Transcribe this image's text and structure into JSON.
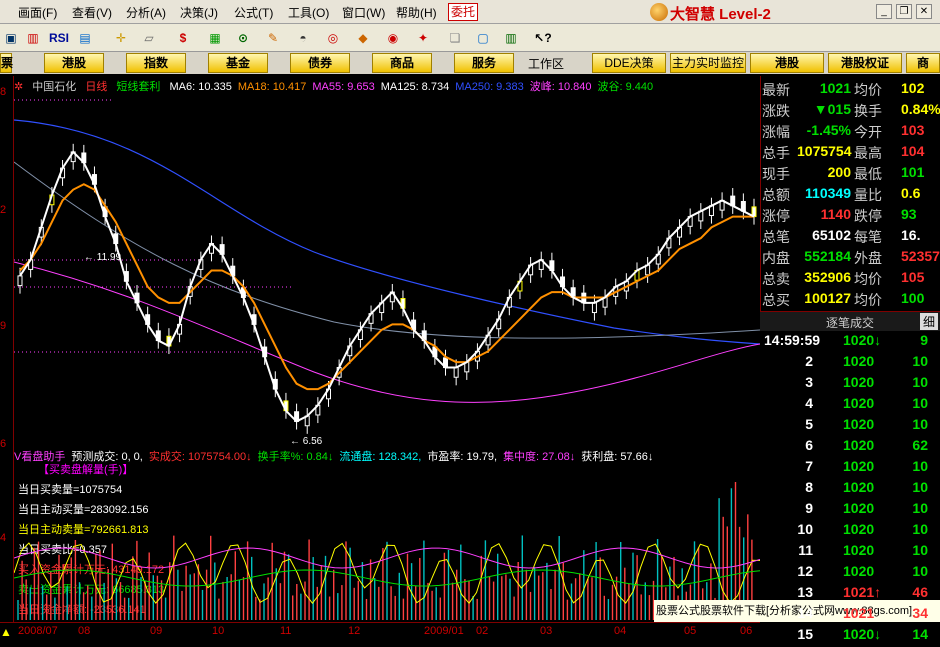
{
  "menu": [
    "画面(F)",
    "查看(V)",
    "分析(A)",
    "决策(J)",
    "公式(T)",
    "工具(O)",
    "窗口(W)",
    "帮助(H)"
  ],
  "menu_entrust": "委托",
  "brand": "大智慧 Level-2",
  "toolbar": {
    "rsi_label": "RSI",
    "dollar_label": "$"
  },
  "tabs": [
    "港股",
    "指数",
    "基金",
    "债券",
    "商品",
    "服务"
  ],
  "tabs_right": [
    "DDE决策",
    "主力实时监控",
    "港股",
    "港股权证",
    "商"
  ],
  "left_tab_stub": "票",
  "workspace_label": "工作区",
  "chart": {
    "title": "中国石化",
    "period": "日线",
    "indicator_name": "短线套利",
    "ma": [
      {
        "label": "MA6: 10.335",
        "color": "#ffffff"
      },
      {
        "label": "MA18: 10.417",
        "color": "#ff9000"
      },
      {
        "label": "MA55: 9.653",
        "color": "#ff40ff"
      },
      {
        "label": "MA125: 8.734",
        "color": "#ffffff"
      },
      {
        "label": "MA250: 9.383",
        "color": "#3050ff"
      },
      {
        "label": "波峰: 10.840",
        "color": "#ff40ff"
      },
      {
        "label": "波谷: 9.440",
        "color": "#00e000"
      }
    ],
    "annotations": {
      "high": "11.99",
      "low": "6.56"
    },
    "axis_labels": [
      "8",
      "2",
      "9",
      "6",
      "4"
    ],
    "dates": [
      "2008/07",
      "08",
      "09",
      "10",
      "11",
      "12",
      "2009/01",
      "02",
      "03",
      "04",
      "05",
      "06"
    ]
  },
  "chart_data": {
    "type": "candlestick",
    "series": [
      {
        "name": "MA6",
        "values": [
          9.3,
          9.6,
          10.2,
          10.8,
          11.3,
          11.6,
          11.4,
          11.0,
          10.4,
          9.9,
          9.2,
          8.8,
          8.4,
          8.1,
          8.0,
          8.4,
          9.1,
          9.6,
          9.9,
          9.7,
          9.3,
          8.9,
          8.4,
          7.8,
          7.2,
          6.8,
          6.6,
          6.7,
          6.9,
          7.2,
          7.6,
          8.0,
          8.3,
          8.6,
          8.8,
          9.0,
          8.7,
          8.3,
          8.1,
          7.8,
          7.6,
          7.6,
          7.7,
          7.9,
          8.2,
          8.5,
          8.9,
          9.2,
          9.5,
          9.6,
          9.4,
          9.1,
          8.9,
          8.8,
          8.8,
          8.9,
          9.1,
          9.2,
          9.4,
          9.5,
          9.7,
          10.0,
          10.2,
          10.4,
          10.5,
          10.6,
          10.7,
          10.6,
          10.5,
          10.4
        ]
      },
      {
        "name": "MA18",
        "values": [
          9.4,
          9.6,
          9.9,
          10.3,
          10.7,
          10.9,
          11.0,
          10.9,
          10.6,
          10.3,
          9.9,
          9.5,
          9.1,
          8.9,
          8.8,
          8.8,
          9.0,
          9.2,
          9.4,
          9.4,
          9.3,
          9.1,
          8.8,
          8.4,
          8.0,
          7.6,
          7.3,
          7.2,
          7.2,
          7.3,
          7.5,
          7.7,
          7.9,
          8.1,
          8.3,
          8.4,
          8.4,
          8.3,
          8.1,
          8.0,
          7.8,
          7.7,
          7.7,
          7.8,
          7.9,
          8.1,
          8.3,
          8.5,
          8.7,
          8.9,
          9.0,
          9.0,
          8.9,
          8.9,
          8.9,
          8.9,
          9.0,
          9.1,
          9.2,
          9.3,
          9.4,
          9.6,
          9.8,
          9.9,
          10.0,
          10.2,
          10.3,
          10.4,
          10.4,
          10.4
        ]
      }
    ]
  },
  "indicator": {
    "header": [
      {
        "text": "V看盘助手",
        "color": "#ff40ff"
      },
      {
        "text": "预测成交: 0, 0,",
        "color": "#ffffff"
      },
      {
        "text": "实成交: 1075754.00↓",
        "color": "#ff3030"
      },
      {
        "text": "换手率%: 0.84↓",
        "color": "#00e000"
      },
      {
        "text": "流通盘: 128.342,",
        "color": "#00ffff"
      },
      {
        "text": "市盈率: 19.79,",
        "color": "#ffffff"
      },
      {
        "text": "集中度: 27.08↓",
        "color": "#ff40ff"
      },
      {
        "text": "获利盘: 57.66↓",
        "color": "#ffffff"
      }
    ],
    "subheader": "【买卖盘解量(手)】",
    "lines": [
      {
        "text": "当日买卖量=1075754",
        "color": "#ffffff"
      },
      {
        "text": "当日主动买量=283092.156",
        "color": "#ffffff"
      },
      {
        "text": "当日主动卖量=792661.813",
        "color": "#ffff00"
      },
      {
        "text": "当日买卖比=0.357",
        "color": "#ffffff"
      },
      {
        "text": "买入资金累计万元: 43149.172",
        "color": "#ff3030"
      },
      {
        "text": "卖出资金累计万元: 66685.313",
        "color": "#00e000"
      },
      {
        "text": "当日资金净额: -23536.141",
        "color": "#ff3030"
      }
    ]
  },
  "watermark": "股票公式股票软件下载[分析家公式网www.88gs.com]",
  "quote": [
    {
      "l1": "最新",
      "v1": "1021",
      "c1": "#00e000",
      "l2": "均价",
      "v2": "102",
      "c2": "#ffff00"
    },
    {
      "l1": "涨跌",
      "v1": "▼015",
      "c1": "#00e000",
      "l2": "换手",
      "v2": "0.84%",
      "c2": "#ffff00"
    },
    {
      "l1": "涨幅",
      "v1": "-1.45%",
      "c1": "#00e000",
      "l2": "今开",
      "v2": "103",
      "c2": "#ff3030"
    },
    {
      "l1": "总手",
      "v1": "1075754",
      "c1": "#ffff00",
      "l2": "最高",
      "v2": "104",
      "c2": "#ff3030"
    },
    {
      "l1": "现手",
      "v1": "200",
      "c1": "#ffff00",
      "l2": "最低",
      "v2": "101",
      "c2": "#00e000"
    },
    {
      "l1": "总额",
      "v1": "110349",
      "c1": "#00ffff",
      "l2": "量比",
      "v2": "0.6",
      "c2": "#ffff00"
    },
    {
      "l1": "涨停",
      "v1": "1140",
      "c1": "#ff3030",
      "l2": "跌停",
      "v2": "93",
      "c2": "#00e000"
    },
    {
      "l1": "总笔",
      "v1": "65102",
      "c1": "#ffffff",
      "l2": "每笔",
      "v2": "16.",
      "c2": "#ffffff"
    },
    {
      "l1": "内盘",
      "v1": "552184",
      "c1": "#00e000",
      "l2": "外盘",
      "v2": "52357",
      "c2": "#ff3030"
    },
    {
      "l1": "总卖",
      "v1": "352906",
      "c1": "#ffff00",
      "l2": "均价",
      "v2": "105",
      "c2": "#ff3030"
    },
    {
      "l1": "总买",
      "v1": "100127",
      "c1": "#ffff00",
      "l2": "均价",
      "v2": "100",
      "c2": "#00e000"
    }
  ],
  "ticks_header": "逐笔成交",
  "ticks_detail": "细",
  "ticks": [
    {
      "idx": "14:59:59",
      "price": "1020↓",
      "pc": "#00e000",
      "vol": "9",
      "vc": "#00e000"
    },
    {
      "idx": "2",
      "price": "1020",
      "pc": "#00e000",
      "vol": "10",
      "vc": "#00e000"
    },
    {
      "idx": "3",
      "price": "1020",
      "pc": "#00e000",
      "vol": "10",
      "vc": "#00e000"
    },
    {
      "idx": "4",
      "price": "1020",
      "pc": "#00e000",
      "vol": "10",
      "vc": "#00e000"
    },
    {
      "idx": "5",
      "price": "1020",
      "pc": "#00e000",
      "vol": "10",
      "vc": "#00e000"
    },
    {
      "idx": "6",
      "price": "1020",
      "pc": "#00e000",
      "vol": "62",
      "vc": "#00e000"
    },
    {
      "idx": "7",
      "price": "1020",
      "pc": "#00e000",
      "vol": "10",
      "vc": "#00e000"
    },
    {
      "idx": "8",
      "price": "1020",
      "pc": "#00e000",
      "vol": "10",
      "vc": "#00e000"
    },
    {
      "idx": "9",
      "price": "1020",
      "pc": "#00e000",
      "vol": "10",
      "vc": "#00e000"
    },
    {
      "idx": "10",
      "price": "1020",
      "pc": "#00e000",
      "vol": "10",
      "vc": "#00e000"
    },
    {
      "idx": "11",
      "price": "1020",
      "pc": "#00e000",
      "vol": "10",
      "vc": "#00e000"
    },
    {
      "idx": "12",
      "price": "1020",
      "pc": "#00e000",
      "vol": "10",
      "vc": "#00e000"
    },
    {
      "idx": "13",
      "price": "1021↑",
      "pc": "#ff3030",
      "vol": "46",
      "vc": "#ff3030"
    },
    {
      "idx": "14",
      "price": "1021",
      "pc": "#ff3030",
      "vol": "34",
      "vc": "#ff3030"
    },
    {
      "idx": "15",
      "price": "1020↓",
      "pc": "#00e000",
      "vol": "14",
      "vc": "#00e000"
    }
  ]
}
